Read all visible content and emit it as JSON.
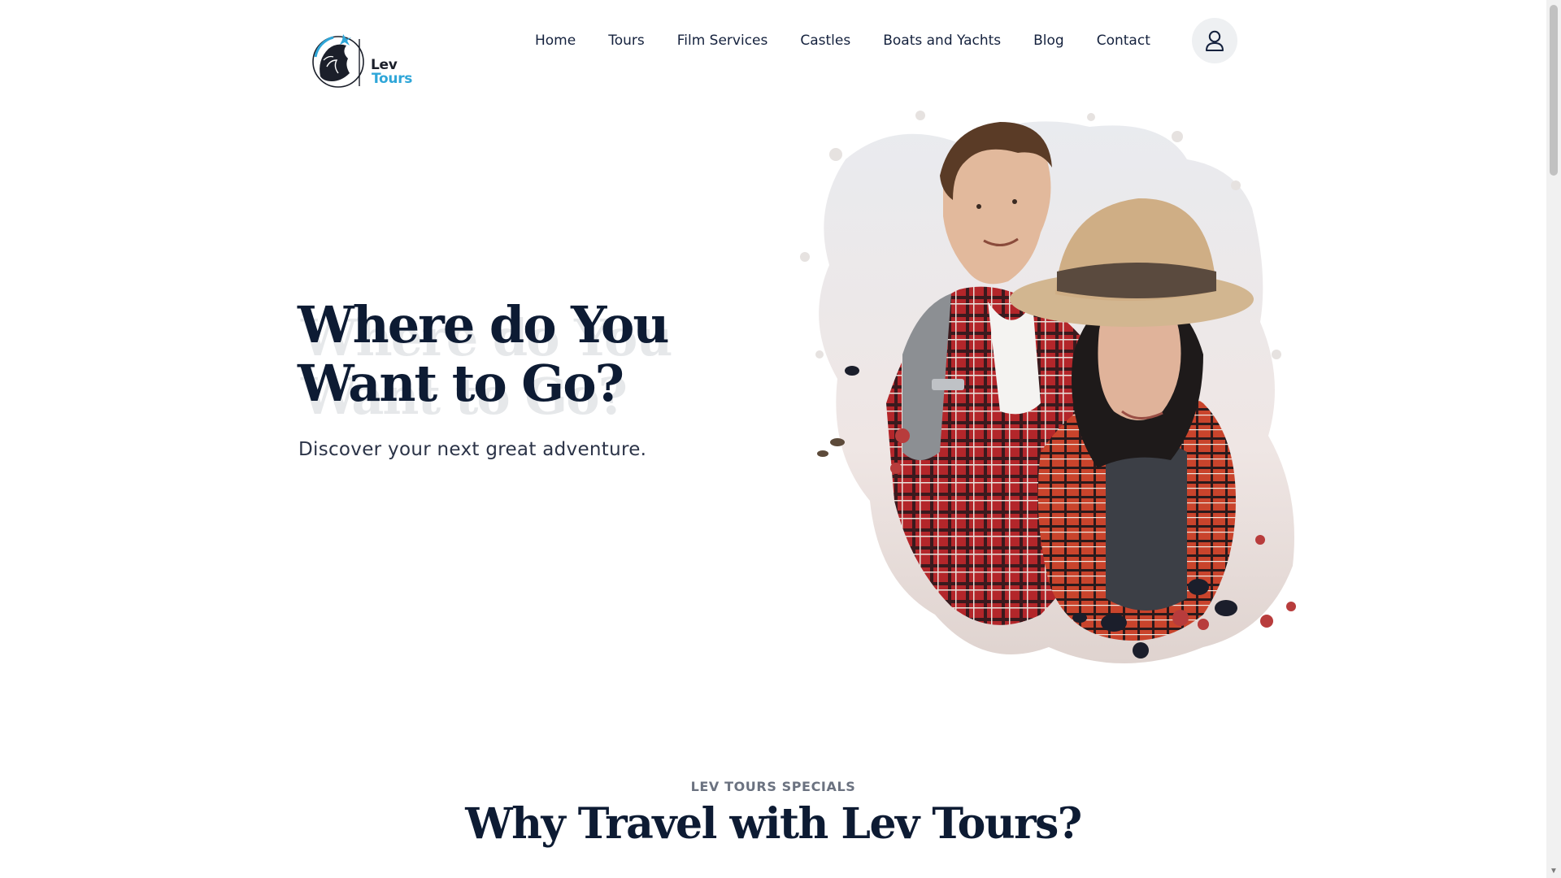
{
  "brand": {
    "logo_line1": "Lev",
    "logo_line2": "Tours",
    "accent": "#2fa6d8"
  },
  "nav": {
    "items": [
      {
        "label": "Home"
      },
      {
        "label": "Tours"
      },
      {
        "label": "Film Services"
      },
      {
        "label": "Castles"
      },
      {
        "label": "Boats and Yachts"
      },
      {
        "label": "Blog"
      },
      {
        "label": "Contact"
      }
    ],
    "account_icon": "user-icon"
  },
  "hero": {
    "title": "Where do You Want to Go?",
    "subtitle": "Discover your next great adventure.",
    "image": "couple-travelers-photo"
  },
  "specials": {
    "eyebrow": "LEV TOURS SPECIALS",
    "title": "Why Travel with Lev Tours?"
  },
  "colors": {
    "heading": "#0d1b33",
    "text": "#2b3347"
  }
}
